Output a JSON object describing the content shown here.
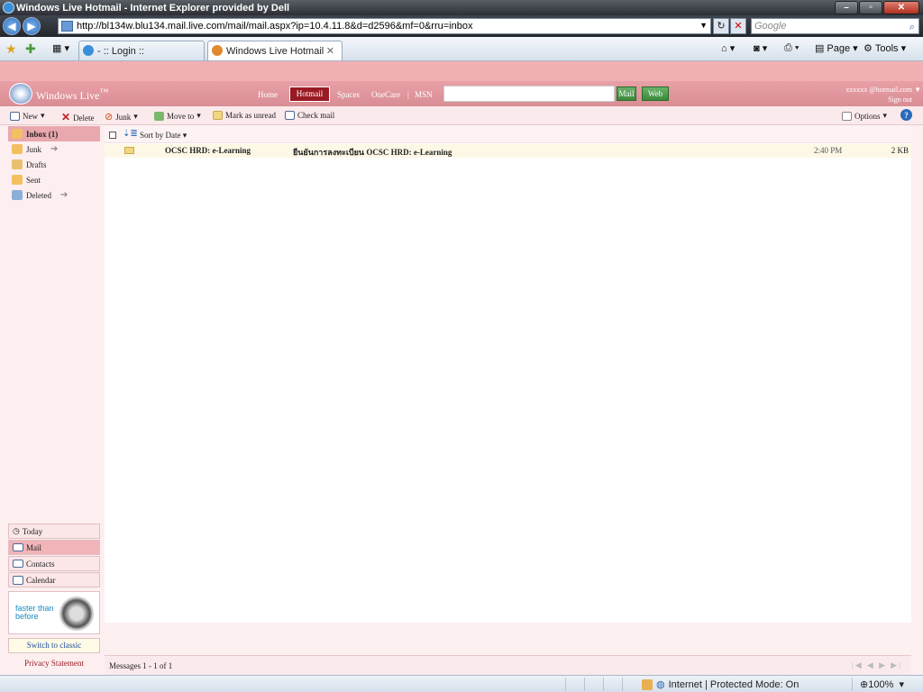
{
  "browser": {
    "title": "Windows Live Hotmail - Internet Explorer provided by Dell",
    "url": "http://bl134w.blu134.mail.live.com/mail/mail.aspx?ip=10.4.11.8&d=d2596&mf=0&rru=inbox",
    "search_placeholder": "Google",
    "tabs": [
      {
        "label": "- :: Login ::"
      },
      {
        "label": "Windows Live Hotmail"
      }
    ],
    "commands": {
      "page": "Page",
      "tools": "Tools"
    },
    "status": {
      "zone": "Internet | Protected Mode: On",
      "zoom": "100%"
    }
  },
  "hotmail": {
    "brand": "Windows Live",
    "brand_tm": "™",
    "nav": {
      "home": "Home",
      "hotmail": "Hotmail",
      "spaces": "Spaces",
      "onecare": "OneCare",
      "msn": "MSN",
      "separator": "|"
    },
    "search_buttons": {
      "mail": "Mail",
      "web": "Web"
    },
    "account": {
      "email": "xxxxxx @hotmail.com",
      "sign_out": "Sign out"
    },
    "toolbar": {
      "new": "New",
      "delete": "Delete",
      "junk": "Junk",
      "move_to": "Move to",
      "mark_unread": "Mark as unread",
      "check_mail": "Check mail",
      "options": "Options"
    },
    "folders": [
      {
        "label": "Inbox (1)"
      },
      {
        "label": "Junk"
      },
      {
        "label": "Drafts"
      },
      {
        "label": "Sent"
      },
      {
        "label": "Deleted"
      }
    ],
    "nav_items": [
      {
        "label": "Today"
      },
      {
        "label": "Mail"
      },
      {
        "label": "Contacts"
      },
      {
        "label": "Calendar"
      }
    ],
    "ad": {
      "line1": "faster than",
      "line2": "before"
    },
    "switch_classic": "Switch to classic",
    "privacy": "Privacy Statement",
    "sort_label": "Sort by Date",
    "messages": [
      {
        "from": "OCSC HRD: e-Learning",
        "subject": "ยืนยันการลงทะเบียน OCSC HRD: e-Learning",
        "date": "2:40 PM",
        "size": "2 KB"
      }
    ],
    "message_count": "Messages 1 - 1 of 1"
  },
  "colors": {
    "accent": "#9a1a24",
    "band": "#e8a0a6",
    "toolbar_bg": "#fbeaec"
  }
}
